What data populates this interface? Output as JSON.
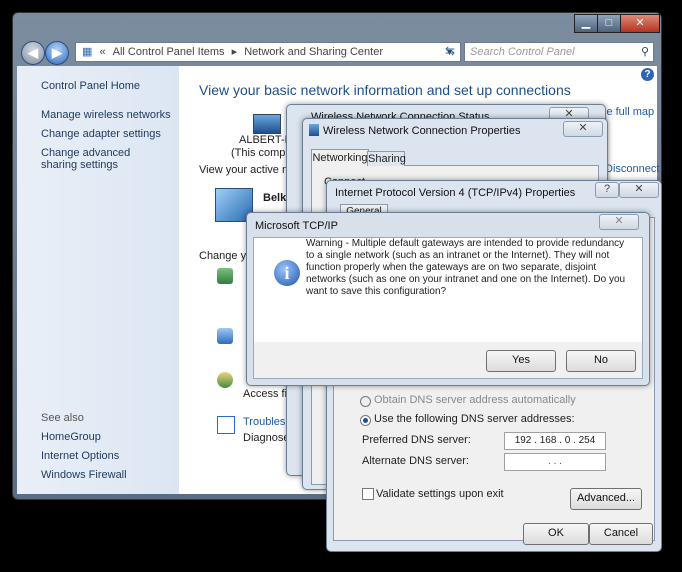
{
  "window": {
    "min_label": "▁",
    "max_label": "□",
    "close_label": "✕"
  },
  "addressbar": {
    "chevrons": "«",
    "crumbs": [
      "All Control Panel Items",
      "Network and Sharing Center"
    ],
    "search_placeholder": "Search Control Panel"
  },
  "sidebar": {
    "home": "Control Panel Home",
    "items": [
      "Manage wireless networks",
      "Change adapter settings",
      "Change advanced sharing settings"
    ],
    "see_also_title": "See also",
    "see_also": [
      "HomeGroup",
      "Internet Options",
      "Windows Firewall"
    ]
  },
  "main": {
    "heading": "View your basic network information and set up connections",
    "see_full_map": "See full map",
    "computer_name": "ALBERT-PC",
    "computer_sub": "(This computer)",
    "active_networks": "View your active networks",
    "network_name": "Belkin",
    "disconnect": "Disconnect",
    "change_label": "Change your",
    "access_file": "Access file",
    "troubleshoot": "Troubleshoot",
    "diagnose": "Diagnose and"
  },
  "status_dialog": {
    "title": "Wireless Network Connection Status"
  },
  "props_dialog": {
    "title": "Wireless Network Connection Properties",
    "tabs": [
      "Networking",
      "Sharing"
    ],
    "connect_label": "Connect"
  },
  "ipv4_dialog": {
    "title": "Internet Protocol Version 4 (TCP/IPv4) Properties",
    "help": "?",
    "tab": "General",
    "obtain_dns": "Obtain DNS server address automatically",
    "use_dns": "Use the following DNS server addresses:",
    "preferred_label": "Preferred DNS server:",
    "preferred_value": "192 . 168 . 0 . 254",
    "alternate_label": "Alternate DNS server:",
    "alternate_value": ". . .",
    "validate": "Validate settings upon exit",
    "advanced": "Advanced...",
    "ok": "OK",
    "cancel": "Cancel"
  },
  "alert": {
    "title": "Microsoft TCP/IP",
    "message": "Warning - Multiple default gateways are intended to provide redundancy to a single network (such as an intranet or the Internet). They will not function properly when the gateways are on two separate, disjoint networks (such as one on your intranet and one on the Internet). Do you want to save this configuration?",
    "yes": "Yes",
    "no": "No"
  }
}
